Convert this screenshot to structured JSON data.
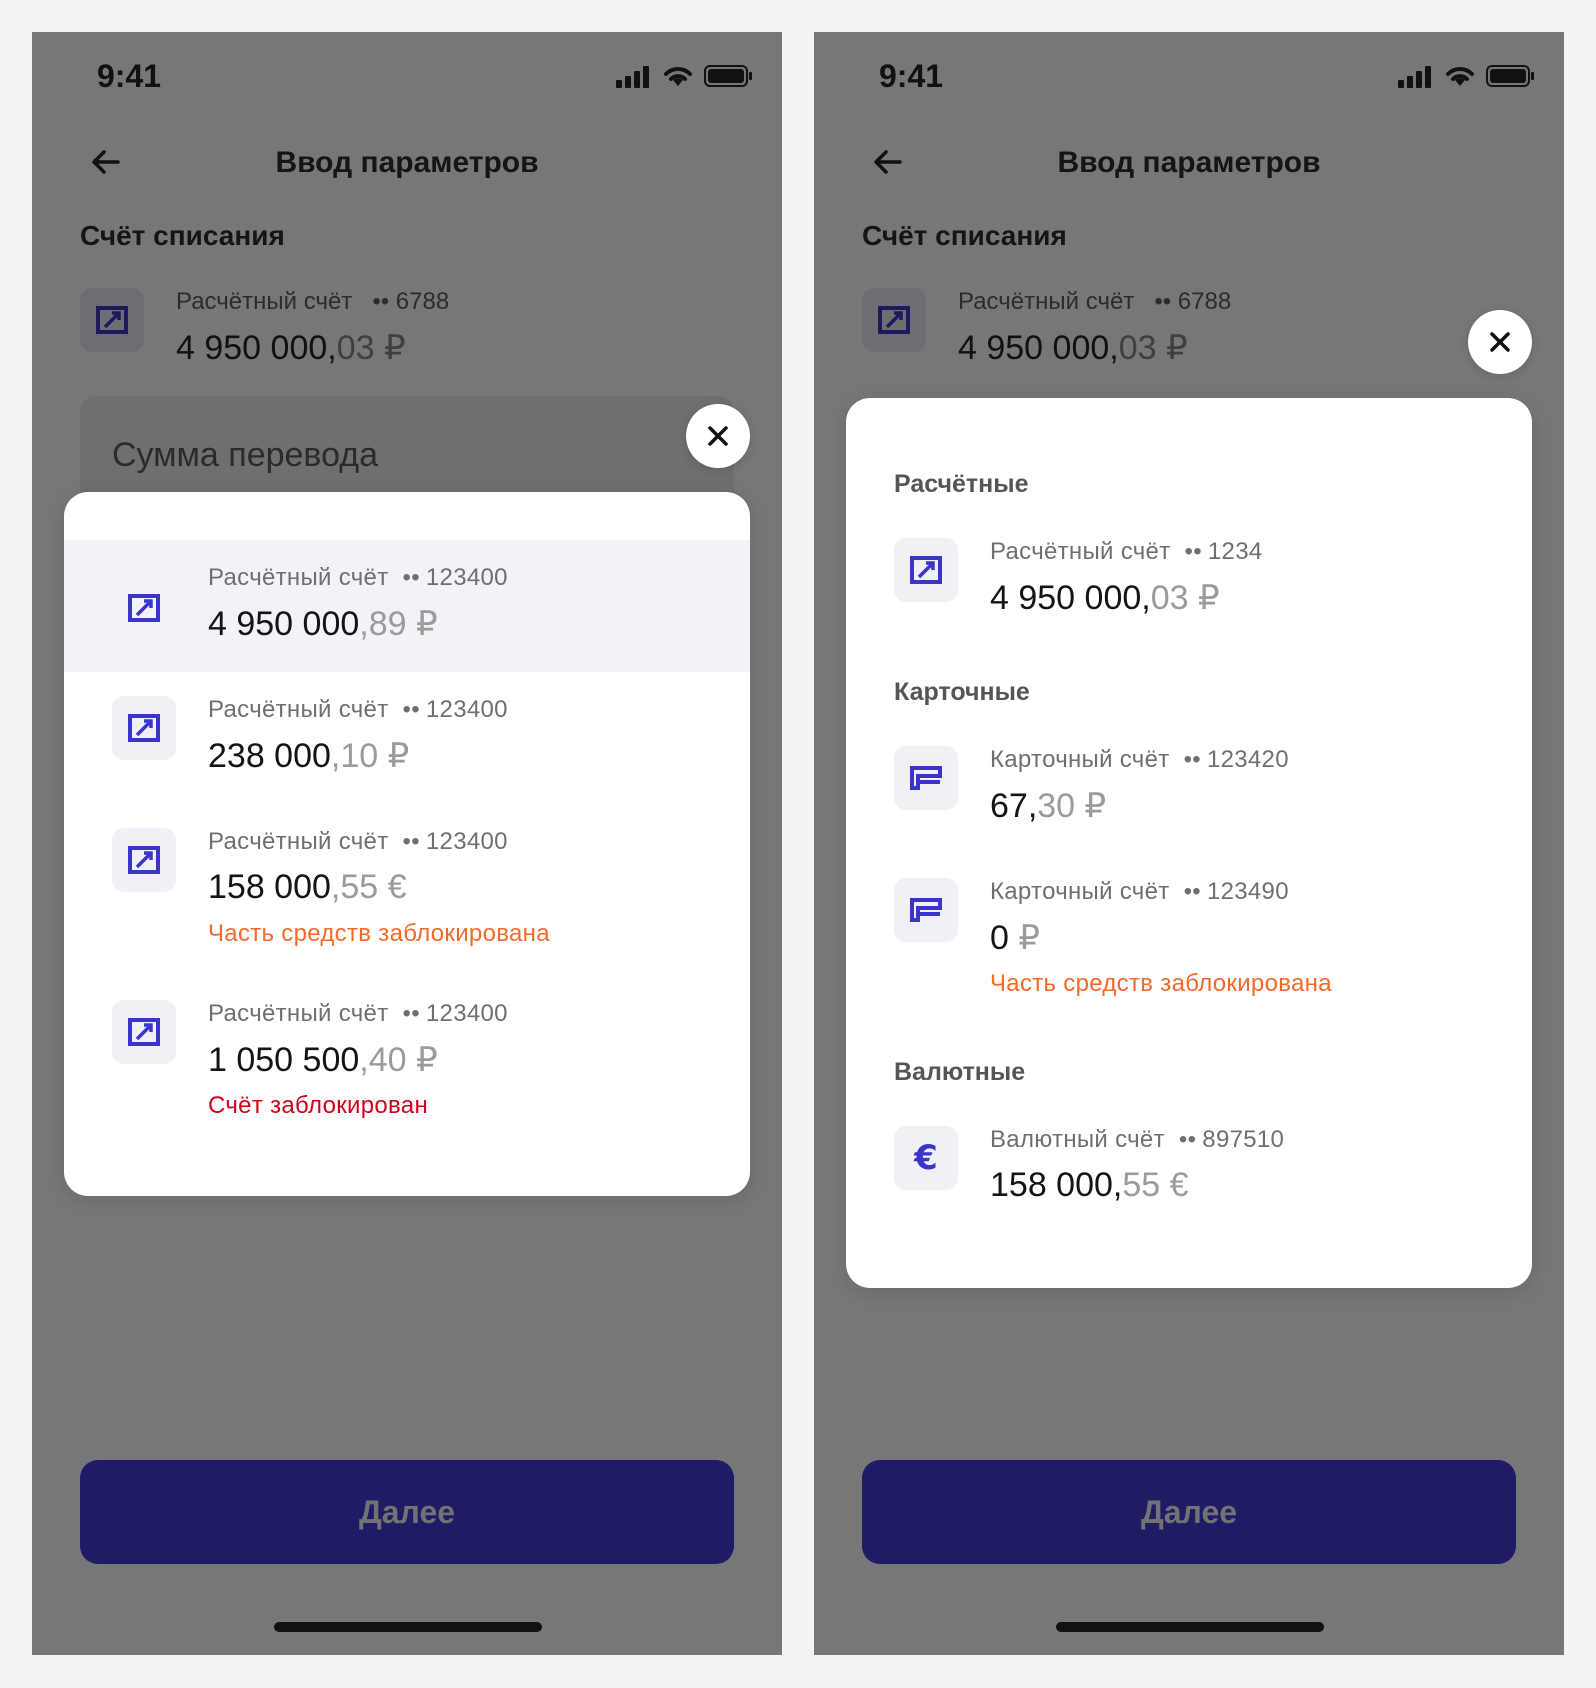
{
  "status": {
    "time": "9:41"
  },
  "header": {
    "title": "Ввод параметров"
  },
  "source": {
    "section_title": "Счёт списания",
    "meta_name": "Расчётный счёт",
    "meta_dots": "••",
    "meta_number": "6788",
    "amount_int": "4 950 000,",
    "amount_frac": "03 ₽"
  },
  "amount_field": {
    "placeholder": "Сумма перевода"
  },
  "left_sheet": {
    "items": [
      {
        "name": "Расчётный счёт",
        "dots": "••",
        "number": "123400",
        "int": "4 950 000",
        "frac": ",89 ₽",
        "note": ""
      },
      {
        "name": "Расчётный счёт",
        "dots": "••",
        "number": "123400",
        "int": "238 000",
        "frac": ",10 ₽",
        "note": ""
      },
      {
        "name": "Расчётный счёт",
        "dots": "••",
        "number": "123400",
        "int": "158 000",
        "frac": ",55 €",
        "note": "Часть средств заблокирована"
      },
      {
        "name": "Расчётный счёт",
        "dots": "••",
        "number": "123400",
        "int": "1 050 500",
        "frac": ",40 ₽",
        "note": "Счёт заблокирован"
      }
    ]
  },
  "right_sheet": {
    "groups": [
      {
        "label": "Расчётные"
      },
      {
        "label": "Карточные"
      },
      {
        "label": "Валютные"
      }
    ],
    "items": [
      {
        "name": "Расчётный счёт",
        "dots": "••",
        "number": "1234",
        "int": "4 950 000,",
        "frac": "03 ₽",
        "note": ""
      },
      {
        "name": "Карточный счёт",
        "dots": "••",
        "number": "123420",
        "int": "67,",
        "frac": "30 ₽",
        "note": ""
      },
      {
        "name": "Карточный счёт",
        "dots": "••",
        "number": "123490",
        "int": "0",
        "frac": " ₽",
        "note": "Часть средств заблокирована"
      },
      {
        "name": "Валютный счёт",
        "dots": "••",
        "number": "897510",
        "int": "158 000,",
        "frac": "55 €",
        "note": ""
      }
    ]
  },
  "footer": {
    "next_label": "Далее"
  },
  "colors": {
    "brand": "#1d1c65",
    "icon": "#3b34c9",
    "warning": "#f36a2a",
    "error": "#d0021b"
  },
  "icons": [
    "arrow-left-icon",
    "close-icon",
    "account-icon",
    "card-icon",
    "euro-icon",
    "signal-icon",
    "wifi-icon",
    "battery-icon"
  ]
}
